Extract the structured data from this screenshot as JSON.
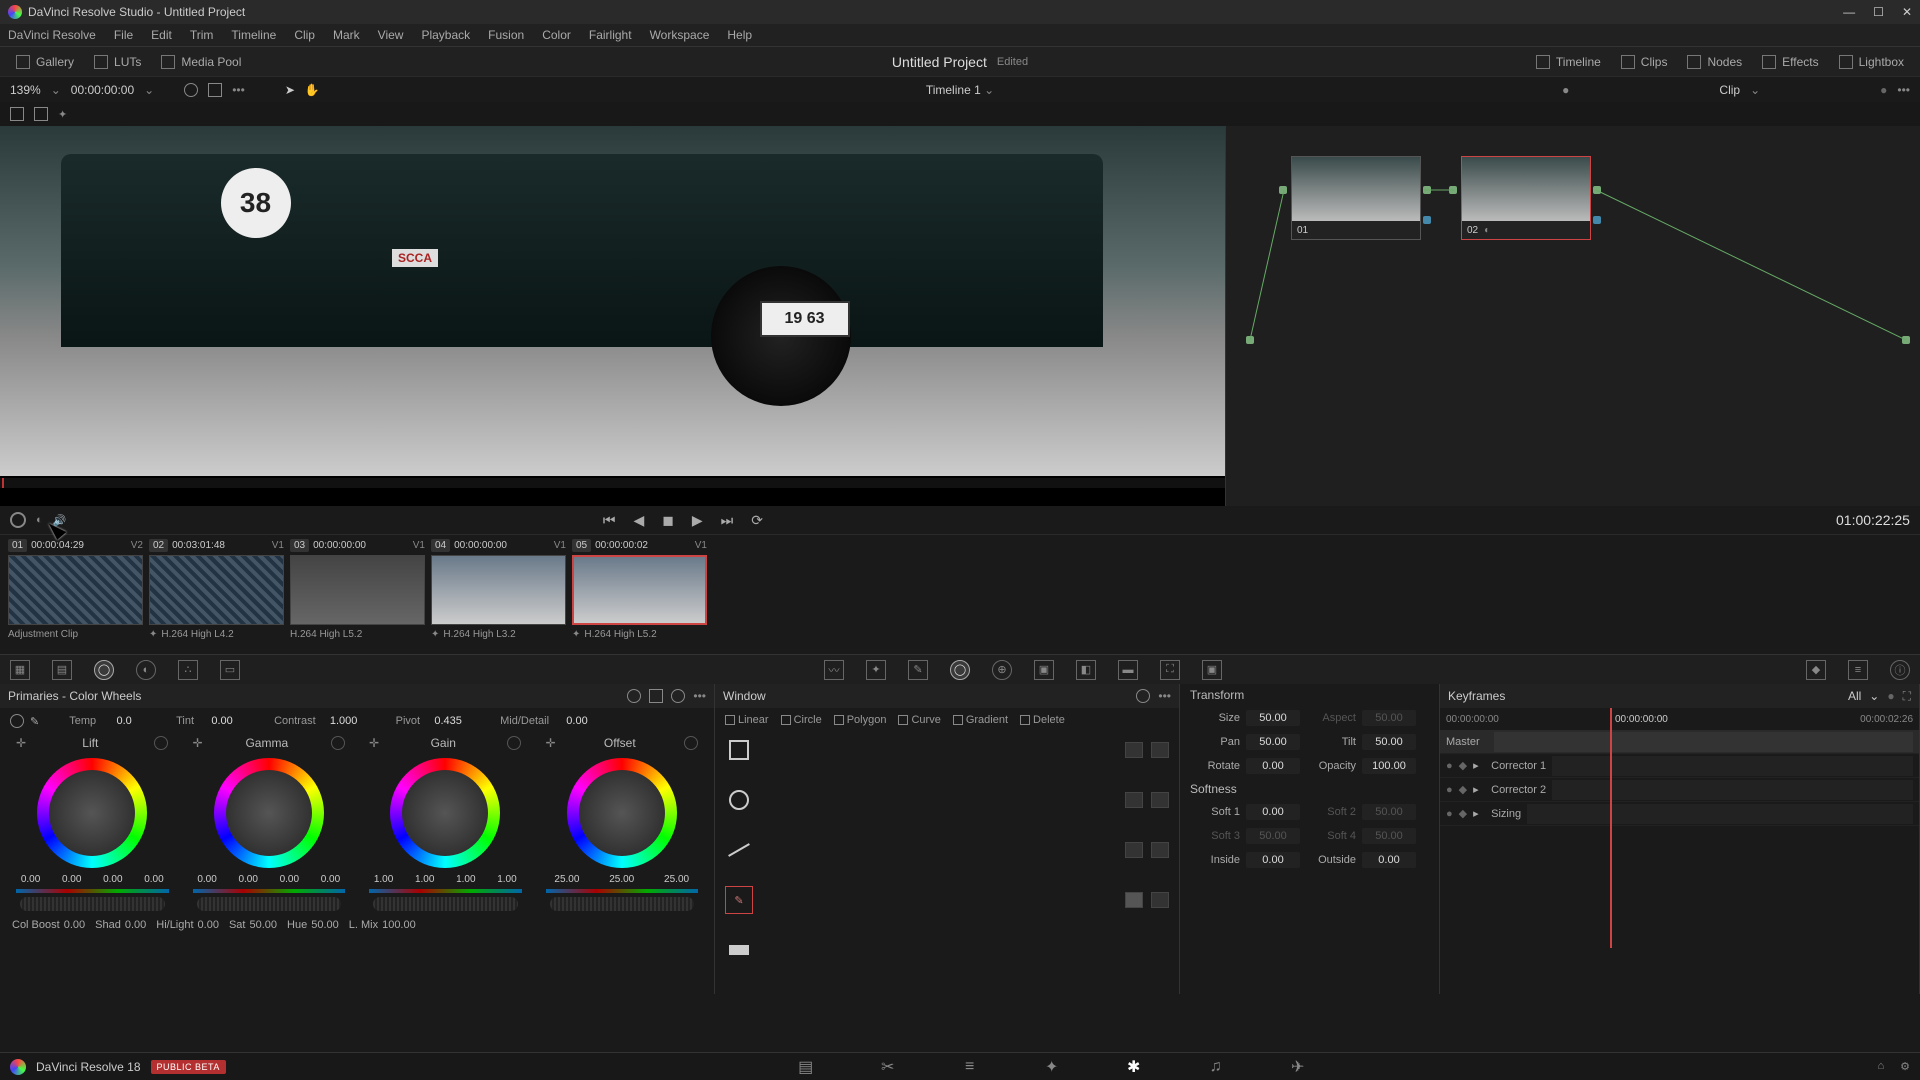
{
  "app": {
    "title": "DaVinci Resolve Studio - Untitled Project"
  },
  "window_buttons": {
    "min": "—",
    "max": "☐",
    "close": "✕"
  },
  "menubar": [
    "DaVinci Resolve",
    "File",
    "Edit",
    "Trim",
    "Timeline",
    "Clip",
    "Mark",
    "View",
    "Playback",
    "Fusion",
    "Color",
    "Fairlight",
    "Workspace",
    "Help"
  ],
  "toolbar_left": [
    {
      "label": "Gallery"
    },
    {
      "label": "LUTs"
    },
    {
      "label": "Media Pool"
    }
  ],
  "toolbar_right": [
    {
      "label": "Timeline"
    },
    {
      "label": "Clips"
    },
    {
      "label": "Nodes"
    },
    {
      "label": "Effects"
    },
    {
      "label": "Lightbox"
    }
  ],
  "project_title": "Untitled Project",
  "project_edited": "Edited",
  "infobar": {
    "zoom": "139%",
    "timeline_name": "Timeline 1",
    "view_tc": "00:00:00:00",
    "clip_label": "Clip"
  },
  "viewer": {
    "plate": "19 63",
    "roundel": "38",
    "badge": "SCCA"
  },
  "transport_tc": "01:00:22:25",
  "nodes": [
    {
      "id": "01"
    },
    {
      "id": "02"
    }
  ],
  "clips": [
    {
      "num": "01",
      "tc": "00:00:04:29",
      "track": "V2",
      "name": "Adjustment Clip",
      "thumb": "adj"
    },
    {
      "num": "02",
      "tc": "00:03:01:48",
      "track": "V1",
      "name": "H.264 High L4.2",
      "thumb": "adj",
      "fx": true
    },
    {
      "num": "03",
      "tc": "00:00:00:00",
      "track": "V1",
      "name": "H.264 High L5.2",
      "thumb": "gray"
    },
    {
      "num": "04",
      "tc": "00:00:00:00",
      "track": "V1",
      "name": "H.264 High L3.2",
      "thumb": "scene",
      "fx": true
    },
    {
      "num": "05",
      "tc": "00:00:00:02",
      "track": "V1",
      "name": "H.264 High L5.2",
      "thumb": "scene",
      "fx": true,
      "sel": true
    }
  ],
  "primaries": {
    "title": "Primaries - Color Wheels",
    "adjust": [
      {
        "lbl": "Temp",
        "val": "0.0"
      },
      {
        "lbl": "Tint",
        "val": "0.00"
      },
      {
        "lbl": "Contrast",
        "val": "1.000"
      },
      {
        "lbl": "Pivot",
        "val": "0.435"
      },
      {
        "lbl": "Mid/Detail",
        "val": "0.00"
      }
    ],
    "wheels": [
      {
        "name": "Lift",
        "vals": [
          "0.00",
          "0.00",
          "0.00",
          "0.00"
        ]
      },
      {
        "name": "Gamma",
        "vals": [
          "0.00",
          "0.00",
          "0.00",
          "0.00"
        ]
      },
      {
        "name": "Gain",
        "vals": [
          "1.00",
          "1.00",
          "1.00",
          "1.00"
        ]
      },
      {
        "name": "Offset",
        "vals": [
          "25.00",
          "25.00",
          "25.00"
        ]
      }
    ],
    "adjust2": [
      {
        "lbl": "Col Boost",
        "val": "0.00"
      },
      {
        "lbl": "Shad",
        "val": "0.00"
      },
      {
        "lbl": "Hi/Light",
        "val": "0.00"
      },
      {
        "lbl": "Sat",
        "val": "50.00"
      },
      {
        "lbl": "Hue",
        "val": "50.00"
      },
      {
        "lbl": "L. Mix",
        "val": "100.00"
      }
    ]
  },
  "window": {
    "title": "Window",
    "tools": [
      "Linear",
      "Circle",
      "Polygon",
      "Curve",
      "Gradient",
      "Delete"
    ]
  },
  "tracker": {
    "transform_title": "Transform",
    "softness_title": "Softness",
    "rows": [
      {
        "l1": "Size",
        "v1": "50.00",
        "l2": "Aspect",
        "v2": "50.00",
        "dim2": true
      },
      {
        "l1": "Pan",
        "v1": "50.00",
        "l2": "Tilt",
        "v2": "50.00"
      },
      {
        "l1": "Rotate",
        "v1": "0.00",
        "l2": "Opacity",
        "v2": "100.00"
      }
    ],
    "soft": [
      {
        "l1": "Soft 1",
        "v1": "0.00",
        "l2": "Soft 2",
        "v2": "50.00",
        "dim2": true
      },
      {
        "l1": "Soft 3",
        "v1": "50.00",
        "dim1": true,
        "l2": "Soft 4",
        "v2": "50.00",
        "dim2": true
      },
      {
        "l1": "Inside",
        "v1": "0.00",
        "l2": "Outside",
        "v2": "0.00"
      }
    ]
  },
  "keyframes": {
    "title": "Keyframes",
    "all": "All",
    "start_tc": "00:00:00:00",
    "cur_tc": "00:00:00:00",
    "end_tc": "00:00:02:26",
    "rows": [
      "Master",
      "Corrector 1",
      "Corrector 2",
      "Sizing"
    ]
  },
  "pagebar": {
    "version": "DaVinci Resolve 18",
    "beta": "PUBLIC BETA"
  }
}
